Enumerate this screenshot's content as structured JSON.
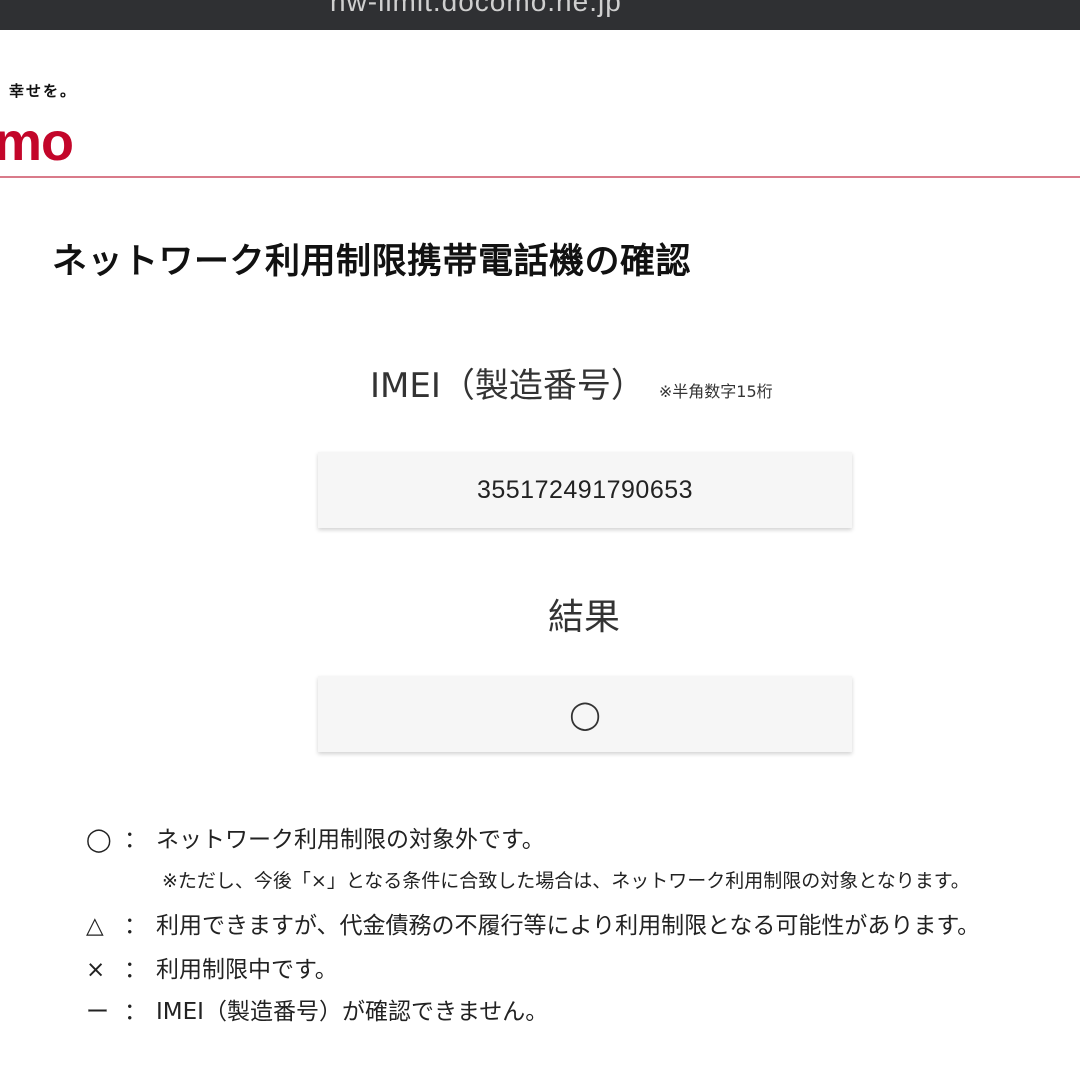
{
  "browser": {
    "url": "nw-limit.docomo.ne.jp"
  },
  "header": {
    "tagline": "、幸せを。",
    "logo": "mo"
  },
  "page_title": "ネットワーク利用制限携帯電話機の確認",
  "imei_section": {
    "label": "IMEI（製造番号）",
    "note": "※半角数字15桁",
    "value": "355172491790653"
  },
  "result_section": {
    "label": "結果",
    "value": "◯"
  },
  "legend": [
    {
      "symbol": "◯",
      "colon": "：",
      "text": "ネットワーク利用制限の対象外です。"
    },
    {
      "note": "※ただし、今後「×」となる条件に合致した場合は、ネットワーク利用制限の対象となります。"
    },
    {
      "symbol": "△",
      "colon": "：",
      "text": "利用できますが、代金債務の不履行等により利用制限となる可能性があります。"
    },
    {
      "symbol": "×",
      "colon": "：",
      "text": "利用制限中です。"
    },
    {
      "symbol": "ー",
      "colon": "：",
      "text": "IMEI（製造番号）が確認できません。"
    }
  ],
  "colors": {
    "brand": "#c3062a",
    "rule": "#d97b8a",
    "topbar": "#2f3033"
  }
}
